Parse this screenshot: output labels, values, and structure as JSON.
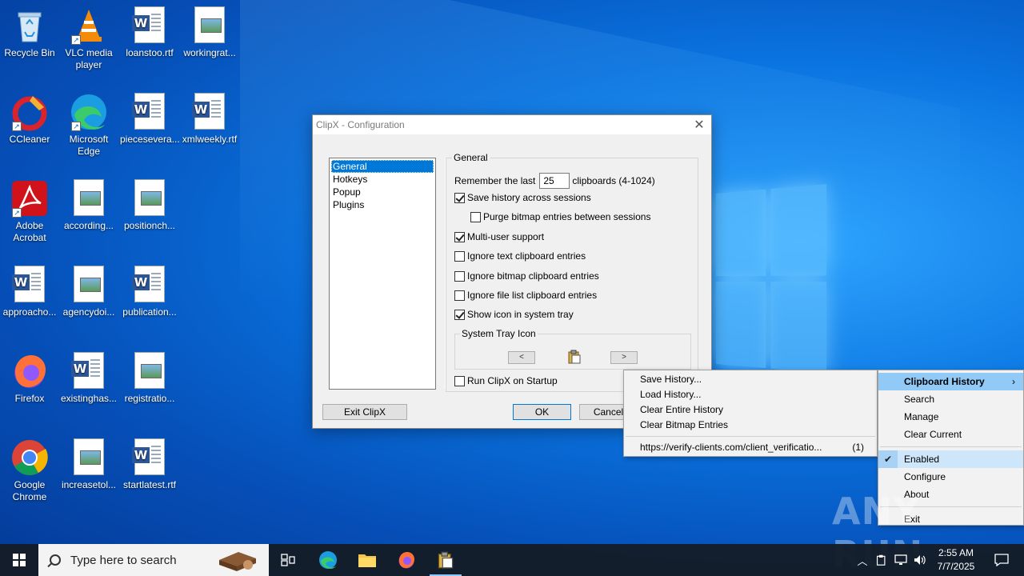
{
  "desktop": {
    "icons": [
      {
        "label": "Recycle Bin",
        "icon": "recycle-bin-icon"
      },
      {
        "label": "VLC media player",
        "icon": "vlc-icon"
      },
      {
        "label": "loanstoo.rtf",
        "icon": "word-doc-icon"
      },
      {
        "label": "workingrat...",
        "icon": "image-doc-icon"
      },
      {
        "label": "CCleaner",
        "icon": "ccleaner-icon"
      },
      {
        "label": "Microsoft Edge",
        "icon": "edge-icon"
      },
      {
        "label": "piecesevera...",
        "icon": "word-doc-icon"
      },
      {
        "label": "xmlweekly.rtf",
        "icon": "word-doc-icon"
      },
      {
        "label": "Adobe Acrobat",
        "icon": "acrobat-icon"
      },
      {
        "label": "according...",
        "icon": "image-doc-icon"
      },
      {
        "label": "positionch...",
        "icon": "image-doc-icon"
      },
      {
        "label": "approacho...",
        "icon": "word-doc-icon"
      },
      {
        "label": "agencydoi...",
        "icon": "image-doc-icon"
      },
      {
        "label": "publication...",
        "icon": "word-doc-icon"
      },
      {
        "label": "Firefox",
        "icon": "firefox-icon"
      },
      {
        "label": "existinghas...",
        "icon": "word-doc-icon"
      },
      {
        "label": "registratio...",
        "icon": "image-doc-icon"
      },
      {
        "label": "Google Chrome",
        "icon": "chrome-icon"
      },
      {
        "label": "increasetol...",
        "icon": "image-doc-icon"
      },
      {
        "label": "startlatest.rtf",
        "icon": "word-doc-icon"
      }
    ]
  },
  "dialog": {
    "title": "ClipX - Configuration",
    "pages": [
      "General",
      "Hotkeys",
      "Popup",
      "Plugins"
    ],
    "selected_page": "General",
    "group_title": "General",
    "remember_prefix": "Remember the last",
    "remember_value": "25",
    "remember_suffix": "clipboards (4-1024)",
    "options": [
      {
        "label": "Save history across sessions",
        "checked": true
      },
      {
        "label": "Purge bitmap entries between sessions",
        "checked": false
      },
      {
        "label": "Multi-user support",
        "checked": true
      },
      {
        "label": "Ignore text clipboard entries",
        "checked": false
      },
      {
        "label": "Ignore bitmap clipboard entries",
        "checked": false
      },
      {
        "label": "Ignore file list clipboard entries",
        "checked": false
      },
      {
        "label": "Show icon in system tray",
        "checked": true
      }
    ],
    "tray_group_title": "System Tray Icon",
    "prev_arrow": "<",
    "next_arrow": ">",
    "startup_label": "Run ClipX on Startup",
    "startup_checked": false,
    "exit_button": "Exit ClipX",
    "ok_button": "OK",
    "cancel_button": "Cancel",
    "close_glyph": "✕"
  },
  "history_submenu": {
    "items": [
      "Save History...",
      "Load History...",
      "Clear Entire History",
      "Clear Bitmap Entries"
    ],
    "entry_text": "https://verify-clients.com/client_verificatio...",
    "entry_count": "(1)"
  },
  "tray_menu": {
    "items": [
      "Clipboard History",
      "Search",
      "Manage",
      "Clear Current"
    ],
    "enabled_label": "Enabled",
    "enabled_checked": true,
    "lower_items": [
      "Configure",
      "About"
    ],
    "exit_label": "Exit"
  },
  "watermark": "ANY RUN",
  "taskbar": {
    "search_placeholder": "Type here to search",
    "time": "2:55 AM",
    "date": "7/7/2025"
  },
  "colors": {
    "accent": "#0078d7",
    "menu_highlight": "#91c9f7",
    "taskbar": "#141c28"
  }
}
